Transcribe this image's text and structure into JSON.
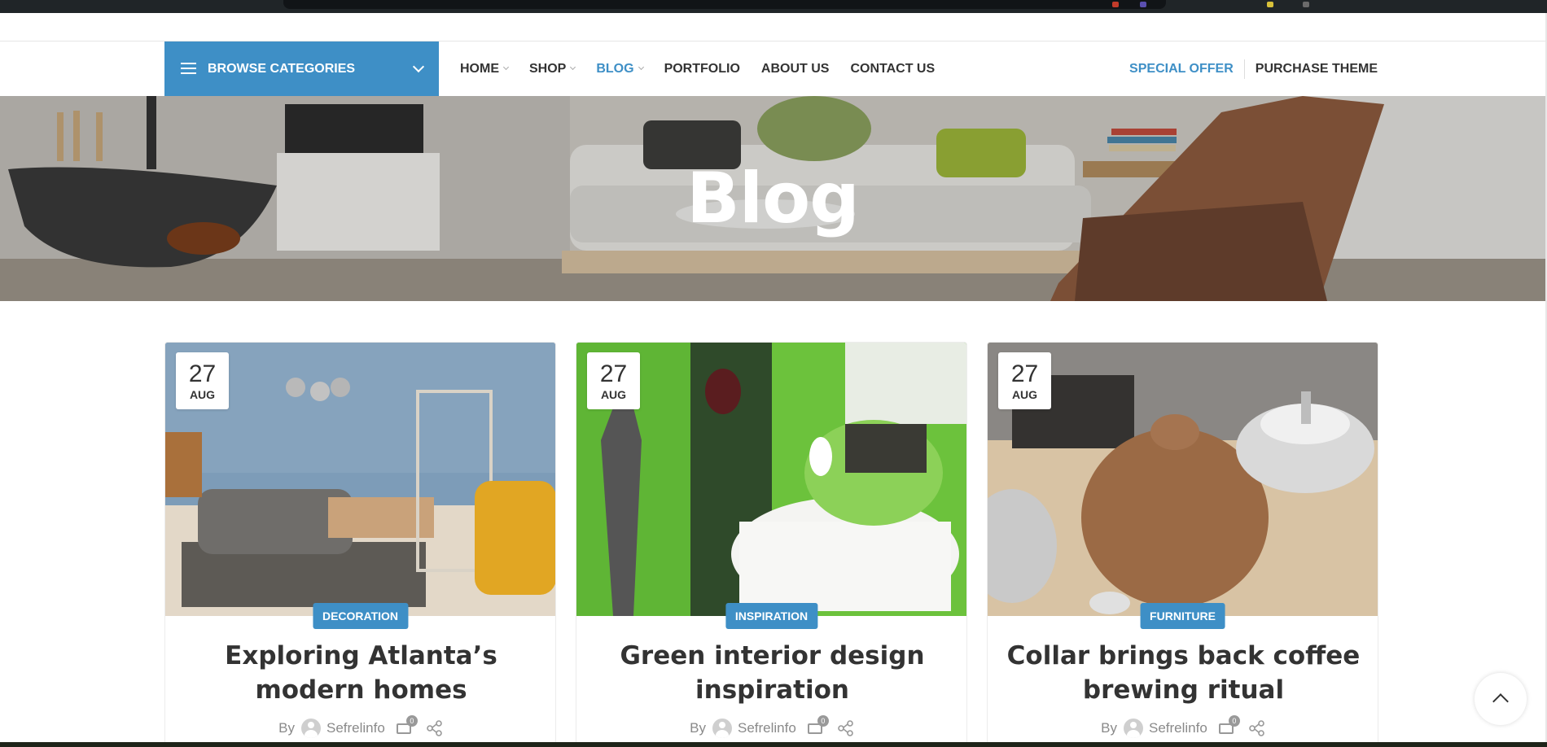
{
  "header": {
    "browse_label": "BROWSE CATEGORIES",
    "nav": [
      {
        "label": "HOME",
        "dropdown": true,
        "active": false
      },
      {
        "label": "SHOP",
        "dropdown": true,
        "active": false
      },
      {
        "label": "BLOG",
        "dropdown": true,
        "active": true
      },
      {
        "label": "PORTFOLIO",
        "dropdown": false,
        "active": false
      },
      {
        "label": "ABOUT US",
        "dropdown": false,
        "active": false
      },
      {
        "label": "CONTACT US",
        "dropdown": false,
        "active": false
      }
    ],
    "special_offer": "SPECIAL OFFER",
    "purchase_theme": "PURCHASE THEME"
  },
  "hero": {
    "title": "Blog"
  },
  "posts": [
    {
      "day": "27",
      "month": "AUG",
      "category": "DECORATION",
      "title": "Exploring Atlanta’s modern homes",
      "by": "By",
      "author": "Sefrelinfo",
      "comments": "0"
    },
    {
      "day": "27",
      "month": "AUG",
      "category": "INSPIRATION",
      "title": "Green interior design inspiration",
      "by": "By",
      "author": "Sefrelinfo",
      "comments": "0"
    },
    {
      "day": "27",
      "month": "AUG",
      "category": "FURNITURE",
      "title": "Collar brings back coffee brewing ritual",
      "by": "By",
      "author": "Sefrelinfo",
      "comments": "0"
    }
  ],
  "colors": {
    "accent": "#3e8fc6",
    "text": "#333333",
    "meta": "#8a8a8a"
  }
}
